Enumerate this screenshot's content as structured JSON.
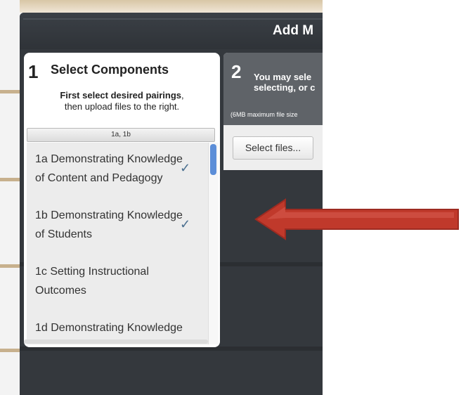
{
  "modal": {
    "title": "Add M"
  },
  "step1": {
    "number": "1",
    "title": "Select Components",
    "instruction_bold": "First select desired pairings",
    "instruction_rest": ",",
    "instruction_line2": "then upload files to the right.",
    "selected": "1a, 1b",
    "items": [
      {
        "label": "1a Demonstrating Knowledge of Content and Pedagogy",
        "checked": true
      },
      {
        "label": "1b Demonstrating Knowledge of Students",
        "checked": true
      },
      {
        "label": "1c Setting Instructional Outcomes",
        "checked": false
      },
      {
        "label": "1d Demonstrating Knowledge",
        "checked": false
      }
    ],
    "check_glyph": "✓"
  },
  "step2": {
    "number": "2",
    "line1": "You may sele",
    "line2": "selecting, or c",
    "note": "(6MB maximum file size",
    "button": "Select files..."
  },
  "colors": {
    "modal_bg": "#34383d",
    "step2_header": "#5f6368",
    "arrow_fill": "#c0392b",
    "check": "#4a6f8f",
    "scroll_thumb": "#5c8ed8"
  }
}
